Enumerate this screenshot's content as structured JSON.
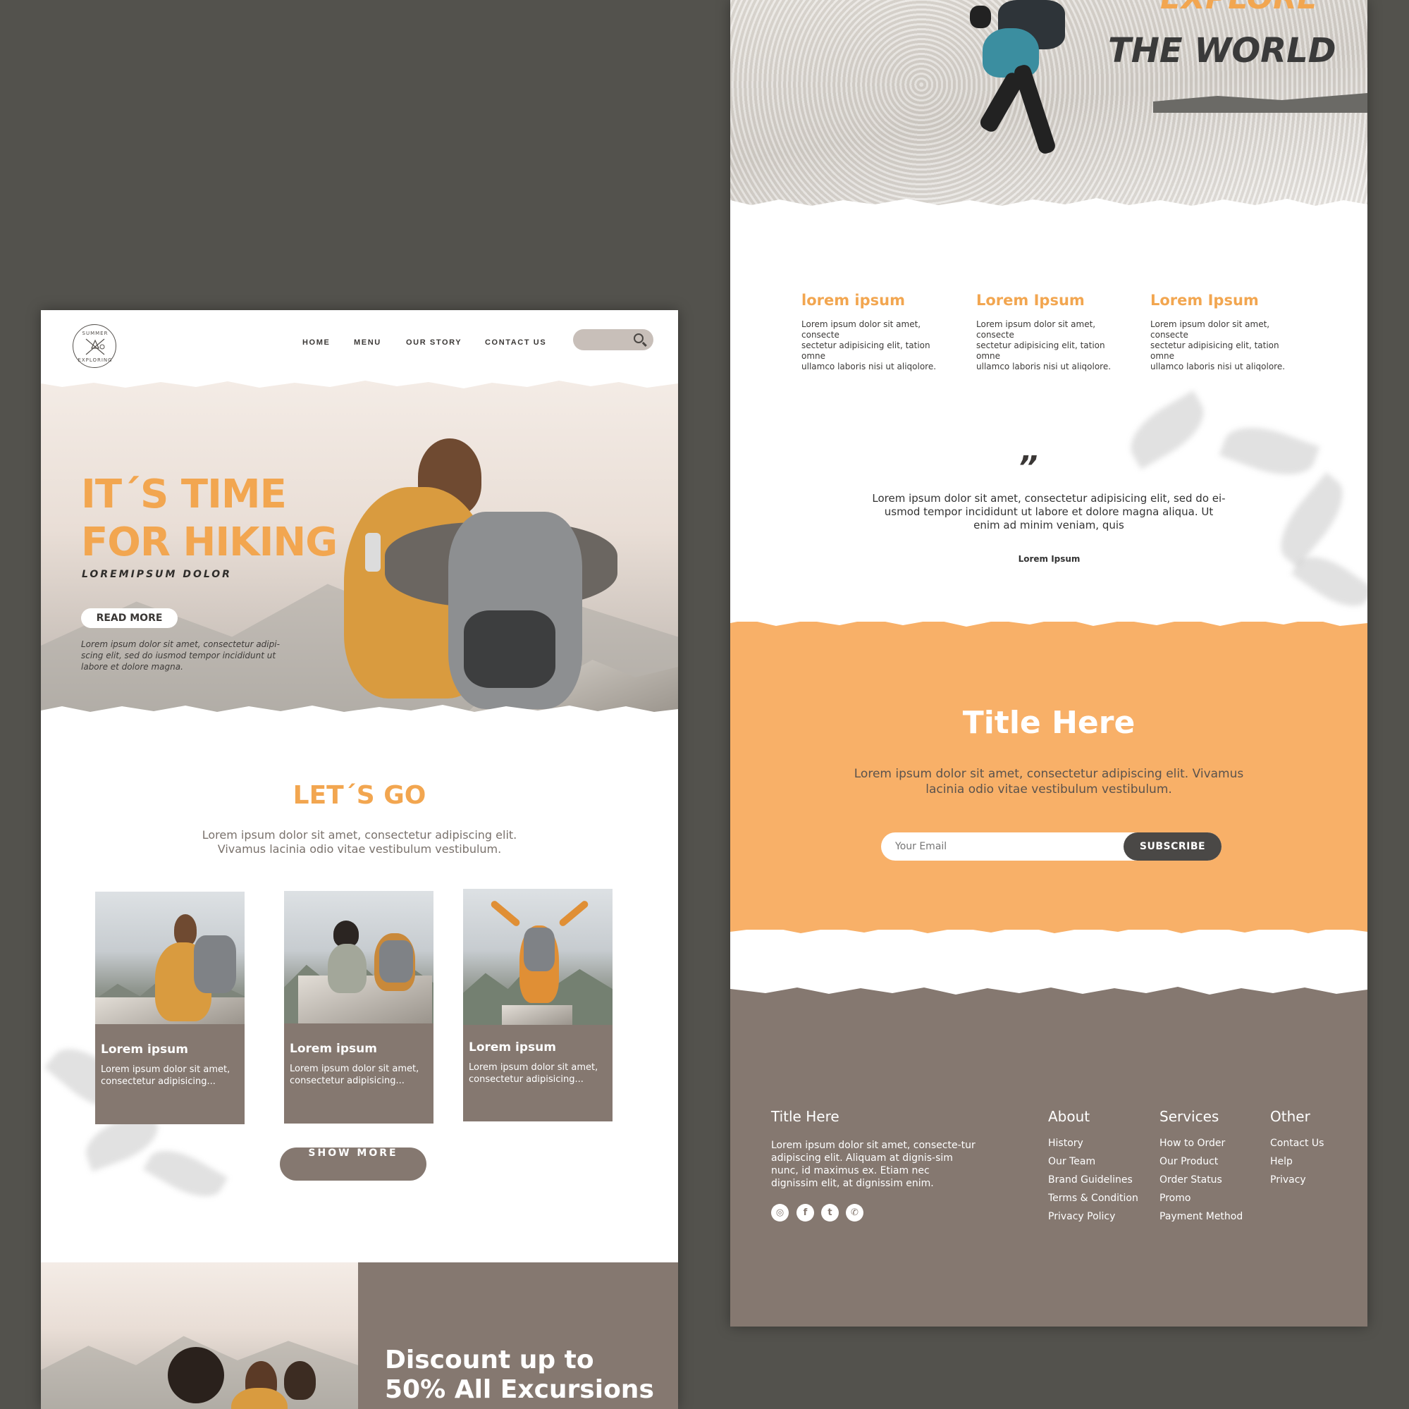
{
  "left": {
    "logo": {
      "top_text": "SUMMER",
      "bottom_text": "EXPLORING"
    },
    "nav": [
      "HOME",
      "MENU",
      "OUR STORY",
      "CONTACT US"
    ],
    "search_icon": "search-icon",
    "hero": {
      "title_line1": "IT´S TIME",
      "title_line2": "FOR HIKING",
      "subtitle": "LOREMIPSUM DOLOR",
      "button": "READ MORE",
      "text": "Lorem ipsum dolor sit amet, consectetur adipi-scing elit, sed do iusmod tempor incididunt ut labore et dolore magna."
    },
    "lets_go": {
      "title": "LET´S GO",
      "line1": "Lorem ipsum dolor sit amet, consectetur adipiscing elit.",
      "line2": "Vivamus lacinia odio vitae vestibulum vestibulum."
    },
    "cards": [
      {
        "title": "Lorem ipsum",
        "line1": "Lorem ipsum dolor sit amet,",
        "line2": "consectetur  adipisicing..."
      },
      {
        "title": "Lorem ipsum",
        "line1": "Lorem ipsum dolor sit amet,",
        "line2": "consectetur  adipisicing..."
      },
      {
        "title": "Lorem ipsum",
        "line1": "Lorem ipsum dolor sit amet,",
        "line2": "consectetur  adipisicing..."
      }
    ],
    "show_more": "SHOW MORE",
    "discount": {
      "line1": "Discount up to",
      "line2": "50% All Excursions"
    }
  },
  "right": {
    "hero": {
      "line1": "EXPLORE",
      "line2": "THE WORLD"
    },
    "columns": [
      {
        "title": "lorem ipsum",
        "line1": "Lorem ipsum dolor sit amet, consecte",
        "line2": "sectetur adipisicing elit, tation omne",
        "line3": "ullamco laboris nisi ut aliqolore."
      },
      {
        "title": "Lorem Ipsum",
        "line1": "Lorem ipsum dolor sit amet, consecte",
        "line2": "sectetur adipisicing elit, tation omne",
        "line3": "ullamco laboris nisi ut aliqolore."
      },
      {
        "title": "Lorem Ipsum",
        "line1": "Lorem ipsum dolor sit amet, consecte",
        "line2": "sectetur adipisicing elit, tation omne",
        "line3": "ullamco laboris nisi ut aliqolore."
      }
    ],
    "quote": {
      "mark": "”",
      "line1": "Lorem ipsum dolor sit amet, consectetur adipisicing elit, sed do ei-",
      "line2": "usmod tempor incididunt ut labore et dolore magna aliqua. Ut",
      "line3": "enim ad minim veniam, quis",
      "author": "Lorem Ipsum"
    },
    "newsletter": {
      "title": "Title Here",
      "line1": "Lorem ipsum dolor sit amet, consectetur adipiscing elit. Vivamus",
      "line2": "lacinia odio vitae vestibulum vestibulum.",
      "email_placeholder": "Your Email",
      "subscribe": "SUBSCRIBE"
    },
    "footer": {
      "title": "Title Here",
      "text": "Lorem ipsum dolor sit amet, consecte-tur adipiscing elit. Aliquam at dignis-sim nunc, id maximus ex. Etiam nec dignissim elit, at dignissim enim.",
      "social_icons": [
        "instagram-icon",
        "facebook-icon",
        "twitter-icon",
        "whatsapp-icon"
      ],
      "about": {
        "heading": "About",
        "links": [
          "History",
          "Our Team",
          "Brand Guidelines",
          "Terms & Condition",
          "Privacy Policy"
        ]
      },
      "services": {
        "heading": "Services",
        "links": [
          "How to Order",
          "Our Product",
          "Order Status",
          "Promo",
          "Payment Method"
        ]
      },
      "other": {
        "heading": "Other",
        "links": [
          "Contact Us",
          "Help",
          "Privacy"
        ]
      }
    }
  },
  "colors": {
    "background": "#53524d",
    "accent_orange": "#f2a650",
    "band_orange": "#f8b068",
    "taupe": "#857870",
    "dark": "#4a4846"
  }
}
